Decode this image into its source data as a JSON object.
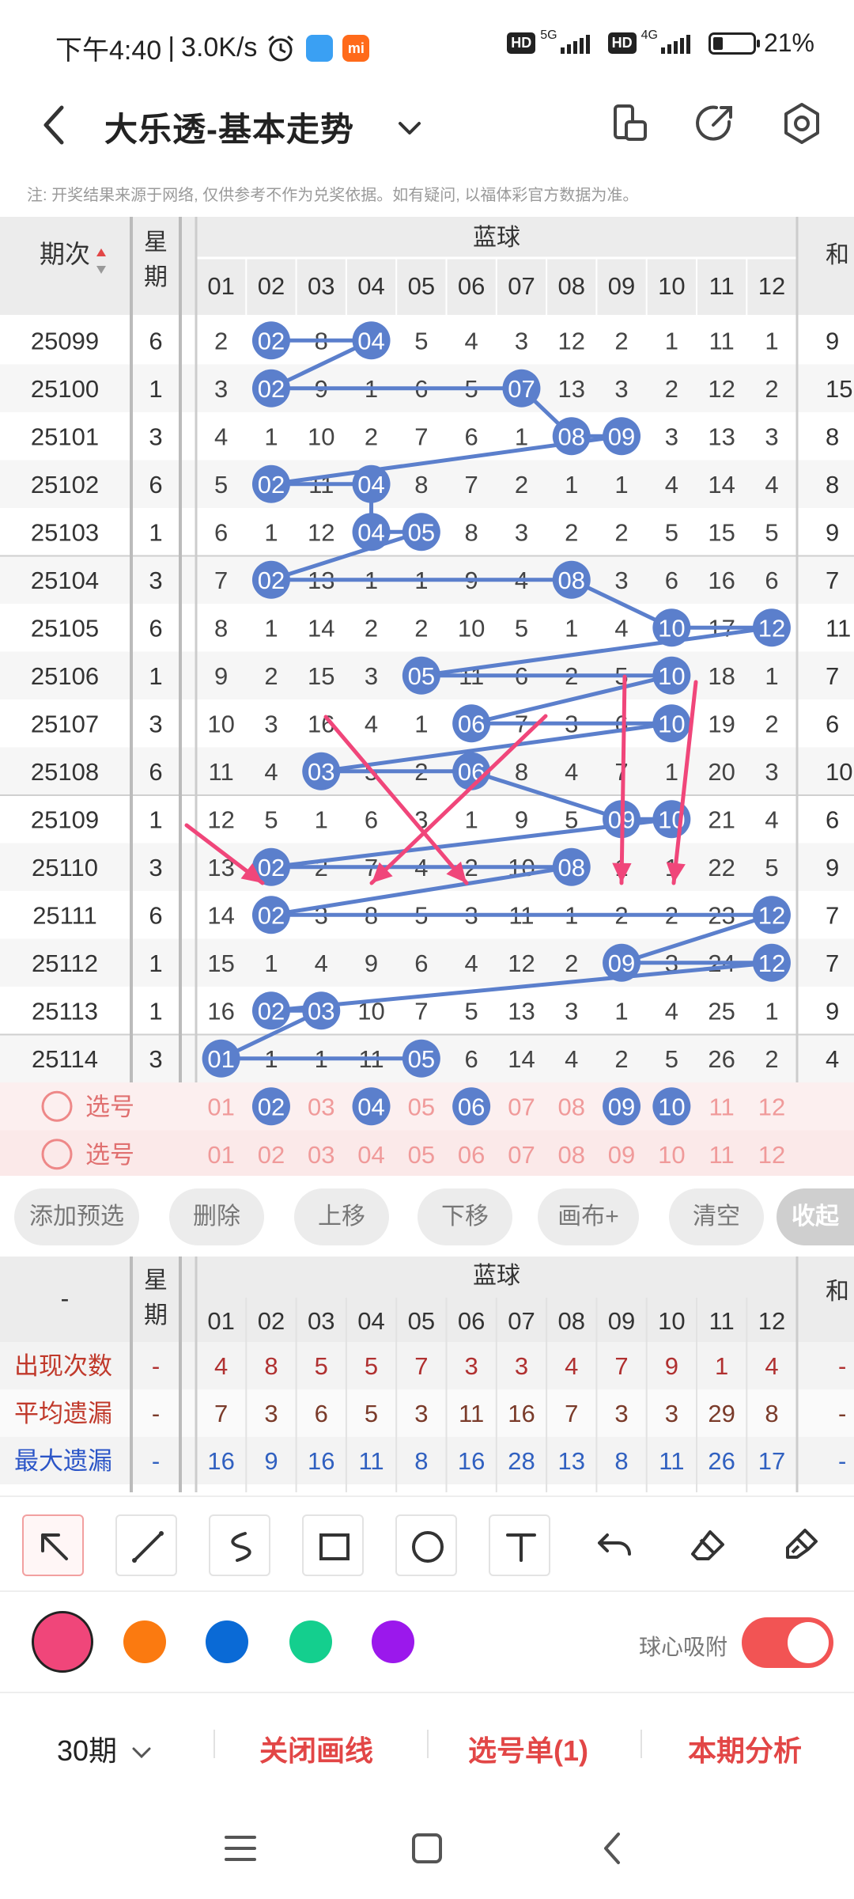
{
  "status_bar": {
    "time": "下午4:40",
    "speed": "3.0K/s",
    "sep": "|",
    "app1_letter": "",
    "app2_letter": "mi",
    "hd1": "HD",
    "net1": "5G",
    "hd2": "HD",
    "net2": "4G",
    "battery": "21%"
  },
  "header": {
    "title": "大乐透-基本走势",
    "back_icon": "chevron-left-icon",
    "dropdown_icon": "chevron-down-icon",
    "icons": [
      "device-rotate-icon",
      "share-icon",
      "settings-icon"
    ]
  },
  "disclaimer": "注: 开奖结果来源于网络, 仅供参考不作为兑奖依据。如有疑问, 以福体彩官方数据为准。",
  "trend_table": {
    "col_period": "期次",
    "col_week": "星期",
    "group_label": "蓝球",
    "col_sum_partial": "和",
    "columns": [
      "01",
      "02",
      "03",
      "04",
      "05",
      "06",
      "07",
      "08",
      "09",
      "10",
      "11",
      "12"
    ],
    "rows": [
      {
        "period": "25099",
        "week": "6",
        "cells": [
          "2",
          "02",
          "8",
          "04",
          "5",
          "4",
          "3",
          "12",
          "2",
          "1",
          "11",
          "1"
        ],
        "sum": "9",
        "hits": [
          2,
          4
        ]
      },
      {
        "period": "25100",
        "week": "1",
        "cells": [
          "3",
          "02",
          "9",
          "1",
          "6",
          "5",
          "07",
          "13",
          "3",
          "2",
          "12",
          "2"
        ],
        "sum": "15",
        "hits": [
          2,
          7
        ]
      },
      {
        "period": "25101",
        "week": "3",
        "cells": [
          "4",
          "1",
          "10",
          "2",
          "7",
          "6",
          "1",
          "08",
          "09",
          "3",
          "13",
          "3"
        ],
        "sum": "8",
        "hits": [
          8,
          9
        ]
      },
      {
        "period": "25102",
        "week": "6",
        "cells": [
          "5",
          "02",
          "11",
          "04",
          "8",
          "7",
          "2",
          "1",
          "1",
          "4",
          "14",
          "4"
        ],
        "sum": "8",
        "hits": [
          2,
          4
        ]
      },
      {
        "period": "25103",
        "week": "1",
        "cells": [
          "6",
          "1",
          "12",
          "04",
          "05",
          "8",
          "3",
          "2",
          "2",
          "5",
          "15",
          "5"
        ],
        "sum": "9",
        "hits": [
          4,
          5
        ]
      },
      {
        "period": "25104",
        "week": "3",
        "cells": [
          "7",
          "02",
          "13",
          "1",
          "1",
          "9",
          "4",
          "08",
          "3",
          "6",
          "16",
          "6"
        ],
        "sum": "7",
        "hits": [
          2,
          8
        ]
      },
      {
        "period": "25105",
        "week": "6",
        "cells": [
          "8",
          "1",
          "14",
          "2",
          "2",
          "10",
          "5",
          "1",
          "4",
          "10",
          "17",
          "12"
        ],
        "sum": "11",
        "hits": [
          10,
          12
        ]
      },
      {
        "period": "25106",
        "week": "1",
        "cells": [
          "9",
          "2",
          "15",
          "3",
          "05",
          "11",
          "6",
          "2",
          "5",
          "10",
          "18",
          "1"
        ],
        "sum": "7",
        "hits": [
          5,
          10
        ]
      },
      {
        "period": "25107",
        "week": "3",
        "cells": [
          "10",
          "3",
          "16",
          "4",
          "1",
          "06",
          "7",
          "3",
          "6",
          "10",
          "19",
          "2"
        ],
        "sum": "6",
        "hits": [
          6,
          10
        ]
      },
      {
        "period": "25108",
        "week": "6",
        "cells": [
          "11",
          "4",
          "03",
          "5",
          "2",
          "06",
          "8",
          "4",
          "7",
          "1",
          "20",
          "3"
        ],
        "sum": "10",
        "hits": [
          3,
          6
        ]
      },
      {
        "period": "25109",
        "week": "1",
        "cells": [
          "12",
          "5",
          "1",
          "6",
          "3",
          "1",
          "9",
          "5",
          "09",
          "10",
          "21",
          "4"
        ],
        "sum": "6",
        "hits": [
          9,
          10
        ]
      },
      {
        "period": "25110",
        "week": "3",
        "cells": [
          "13",
          "02",
          "2",
          "7",
          "4",
          "2",
          "10",
          "08",
          "1",
          "1",
          "22",
          "5"
        ],
        "sum": "9",
        "hits": [
          2,
          8
        ]
      },
      {
        "period": "25111",
        "week": "6",
        "cells": [
          "14",
          "02",
          "3",
          "8",
          "5",
          "3",
          "11",
          "1",
          "2",
          "2",
          "23",
          "12"
        ],
        "sum": "7",
        "hits": [
          2,
          12
        ]
      },
      {
        "period": "25112",
        "week": "1",
        "cells": [
          "15",
          "1",
          "4",
          "9",
          "6",
          "4",
          "12",
          "2",
          "09",
          "3",
          "24",
          "12"
        ],
        "sum": "7",
        "hits": [
          9,
          12
        ]
      },
      {
        "period": "25113",
        "week": "1",
        "cells": [
          "16",
          "02",
          "03",
          "10",
          "7",
          "5",
          "13",
          "3",
          "1",
          "4",
          "25",
          "1"
        ],
        "sum": "9",
        "hits": [
          2,
          3
        ]
      },
      {
        "period": "25114",
        "week": "3",
        "cells": [
          "01",
          "1",
          "1",
          "11",
          "05",
          "6",
          "14",
          "4",
          "2",
          "5",
          "26",
          "2"
        ],
        "sum": "4",
        "hits": [
          1,
          5
        ]
      }
    ],
    "pick_rows": [
      {
        "label": "选号",
        "selected": [
          2,
          4,
          6,
          9,
          10
        ]
      },
      {
        "label": "选号",
        "selected": []
      }
    ]
  },
  "actions": [
    "添加预选",
    "删除",
    "上移",
    "下移",
    "画布+",
    "清空",
    "收起"
  ],
  "stats_table": {
    "col_first": "-",
    "col_week": "星期",
    "group_label": "蓝球",
    "col_sum_partial": "和",
    "columns": [
      "01",
      "02",
      "03",
      "04",
      "05",
      "06",
      "07",
      "08",
      "09",
      "10",
      "11",
      "12"
    ],
    "rows": [
      {
        "label": "出现次数",
        "week": "-",
        "values": [
          "4",
          "8",
          "5",
          "5",
          "7",
          "3",
          "3",
          "4",
          "7",
          "9",
          "1",
          "4"
        ],
        "sum": "-",
        "color": "#b03030",
        "label_color": "#c0392b"
      },
      {
        "label": "平均遗漏",
        "week": "-",
        "values": [
          "7",
          "3",
          "6",
          "5",
          "3",
          "11",
          "16",
          "7",
          "3",
          "3",
          "29",
          "8"
        ],
        "sum": "-",
        "color": "#7a3b2a",
        "label_color": "#c0392b"
      },
      {
        "label": "最大遗漏",
        "week": "-",
        "values": [
          "16",
          "9",
          "16",
          "11",
          "8",
          "16",
          "28",
          "13",
          "8",
          "11",
          "26",
          "17"
        ],
        "sum": "-",
        "color": "#3060c0",
        "label_color": "#2b55c7"
      }
    ]
  },
  "tools": [
    "select-arrow-icon",
    "line-icon",
    "curve-icon",
    "rectangle-icon",
    "circle-icon",
    "text-icon",
    "undo-icon",
    "eraser-icon",
    "brush-clear-icon"
  ],
  "colors": [
    "#f0467a",
    "#fb7a10",
    "#0a6ad6",
    "#14cf8e",
    "#9b18ec"
  ],
  "snap": {
    "label": "球心吸附",
    "on": true
  },
  "bottom_bar": {
    "period": "30期",
    "close_lines": "关闭画线",
    "pick_list": "选号单(1)",
    "analysis": "本期分析"
  },
  "nav": [
    "menu-icon",
    "home-icon",
    "back-icon"
  ],
  "palette": {
    "ball": "#5b7fcc",
    "line": "#5b7fcc",
    "arrow": "#f0467a",
    "accent": "#e24646"
  }
}
